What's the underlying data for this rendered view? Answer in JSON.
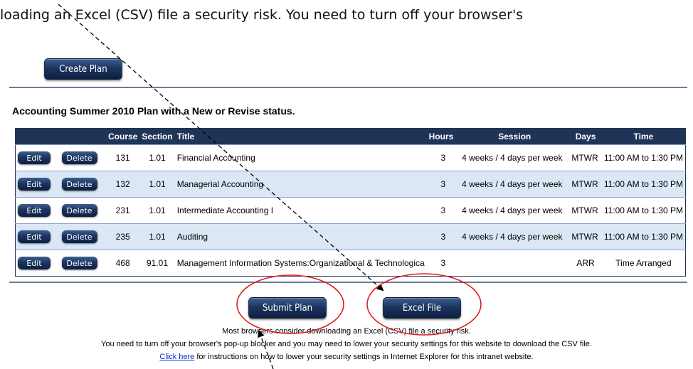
{
  "intro_text": "loading an Excel (CSV) file a security risk. You need to turn off your browser's",
  "create_plan_label": "Create Plan",
  "section_title": "Accounting Summer 2010 Plan with a New or Revise status.",
  "table": {
    "headers": {
      "course": "Course",
      "section": "Section",
      "title": "Title",
      "hours": "Hours",
      "session": "Session",
      "days": "Days",
      "time": "Time"
    },
    "rows": [
      {
        "edit": "Edit",
        "delete": "Delete",
        "course": "131",
        "section": "1.01",
        "title": "Financial Accounting",
        "hours": "3",
        "session": "4 weeks / 4 days per week",
        "days": "MTWR",
        "time": "11:00 AM to 1:30 PM"
      },
      {
        "edit": "Edit",
        "delete": "Delete",
        "course": "132",
        "section": "1.01",
        "title": "Managerial Accounting",
        "hours": "3",
        "session": "4 weeks / 4 days per week",
        "days": "MTWR",
        "time": "11:00 AM to 1:30 PM"
      },
      {
        "edit": "Edit",
        "delete": "Delete",
        "course": "231",
        "section": "1.01",
        "title": "Intermediate Accounting I",
        "hours": "3",
        "session": "4 weeks / 4 days per week",
        "days": "MTWR",
        "time": "11:00 AM to 1:30 PM"
      },
      {
        "edit": "Edit",
        "delete": "Delete",
        "course": "235",
        "section": "1.01",
        "title": "Auditing",
        "hours": "3",
        "session": "4 weeks / 4 days per week",
        "days": "MTWR",
        "time": "11:00 AM to 1:30 PM"
      },
      {
        "edit": "Edit",
        "delete": "Delete",
        "course": "468",
        "section": "91.01",
        "title": "Management Information Systems:Organizational & Technologica",
        "hours": "3",
        "session": "",
        "days": "ARR",
        "time": "Time Arranged"
      }
    ]
  },
  "submit_plan_label": "Submit Plan",
  "excel_file_label": "Excel File",
  "footer": {
    "line1": "Most browsers consider downloading an Excel (CSV) file a security risk.",
    "line2": "You need to turn off your browser's pop-up blocker and you may need to lower your security settings for this website to download the CSV file.",
    "link_text": "Click here",
    "line3_rest": " for instructions on how to lower your security settings in Internet Explorer for this intranet website."
  },
  "annotation_colors": {
    "circle": "#e21b1b",
    "arrow": "#000000"
  }
}
